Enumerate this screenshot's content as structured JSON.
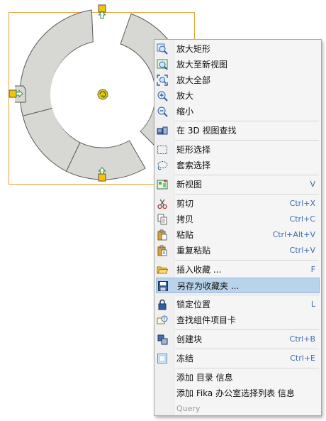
{
  "colors": {
    "selection_frame": "#e8a23a",
    "ring_fill": "#d7d7d4",
    "ring_stroke": "#5a5a5a",
    "handle_fill": "#f5c400",
    "handle_marker": "#2e8b3a",
    "menu_highlight": "#b9d3ea",
    "shortcut_text": "#3b6cb0"
  },
  "context_menu": {
    "items": [
      {
        "label": "放大矩形",
        "shortcut": "",
        "icon": "zoom-rectangle-icon"
      },
      {
        "label": "放大至新视图",
        "shortcut": "",
        "icon": "zoom-new-view-icon"
      },
      {
        "label": "放大全部",
        "shortcut": "",
        "icon": "zoom-all-icon"
      },
      {
        "label": "放大",
        "shortcut": "",
        "icon": "zoom-in-icon"
      },
      {
        "label": "缩小",
        "shortcut": "",
        "icon": "zoom-out-icon"
      },
      {
        "separator": true
      },
      {
        "label": "在 3D 视图查找",
        "shortcut": "",
        "icon": "find-in-3d-icon"
      },
      {
        "separator": true
      },
      {
        "label": "矩形选择",
        "shortcut": "",
        "icon": "rectangle-select-icon"
      },
      {
        "label": "套索选择",
        "shortcut": "",
        "icon": "lasso-select-icon"
      },
      {
        "separator": true
      },
      {
        "label": "新视图",
        "shortcut": "V",
        "icon": "new-view-icon"
      },
      {
        "separator": true
      },
      {
        "label": "剪切",
        "shortcut": "Ctrl+X",
        "icon": "scissors-icon"
      },
      {
        "label": "拷贝",
        "shortcut": "Ctrl+C",
        "icon": "copy-icon"
      },
      {
        "label": "粘贴",
        "shortcut": "Ctrl+Alt+V",
        "icon": "paste-icon"
      },
      {
        "label": "重复粘贴",
        "shortcut": "Ctrl+V",
        "icon": "repeat-paste-icon"
      },
      {
        "separator": true
      },
      {
        "label": "插入收藏 ...",
        "shortcut": "F",
        "icon": "folder-open-icon"
      },
      {
        "label": "另存为收藏夹 ...",
        "shortcut": "",
        "icon": "save-icon",
        "highlighted": true
      },
      {
        "separator": true
      },
      {
        "label": "锁定位置",
        "shortcut": "L",
        "icon": "lock-icon"
      },
      {
        "label": "查找组件项目卡",
        "shortcut": "",
        "icon": "find-component-card-icon"
      },
      {
        "separator": true
      },
      {
        "label": "创建块",
        "shortcut": "Ctrl+B",
        "icon": "create-block-icon"
      },
      {
        "separator": true
      },
      {
        "label": "冻结",
        "shortcut": "Ctrl+E",
        "icon": "freeze-icon"
      },
      {
        "separator": true
      },
      {
        "label": "添加 目录 信息",
        "shortcut": "",
        "icon": ""
      },
      {
        "label": "添加 Fika 办公室选择列表 信息",
        "shortcut": "",
        "icon": ""
      },
      {
        "label": "Query",
        "shortcut": "",
        "icon": "",
        "disabled": true
      }
    ]
  }
}
